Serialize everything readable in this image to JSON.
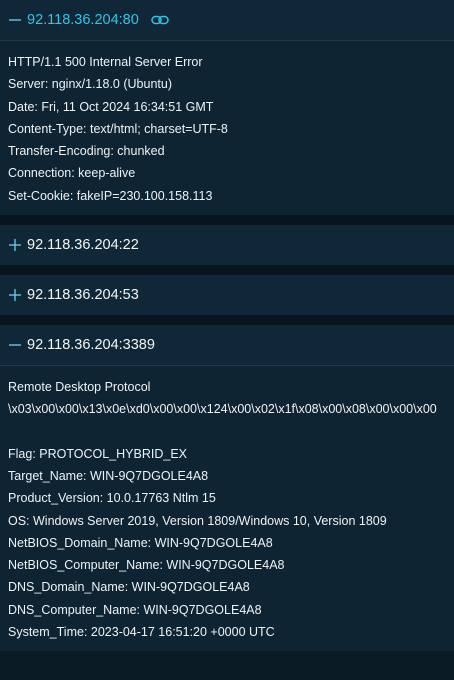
{
  "sections": [
    {
      "title": "92.118.36.204:80",
      "expanded": true,
      "has_link": true,
      "lines": [
        "HTTP/1.1 500 Internal Server Error",
        "Server: nginx/1.18.0 (Ubuntu)",
        "Date: Fri, 11 Oct 2024 16:34:51 GMT",
        "Content-Type: text/html; charset=UTF-8",
        "Transfer-Encoding: chunked",
        "Connection: keep-alive",
        "Set-Cookie: fakeIP=230.100.158.113"
      ]
    },
    {
      "title": "92.118.36.204:22",
      "expanded": false
    },
    {
      "title": "92.118.36.204:53",
      "expanded": false
    },
    {
      "title": "92.118.36.204:3389",
      "expanded": true,
      "lines_head": [
        "Remote Desktop Protocol",
        "\\x03\\x00\\x00\\x13\\x0e\\xd0\\x00\\x00\\x124\\x00\\x02\\x1f\\x08\\x00\\x08\\x00\\x00\\x00"
      ],
      "lines": [
        "Flag: PROTOCOL_HYBRID_EX",
        "Target_Name: WIN-9Q7DGOLE4A8",
        "Product_Version: 10.0.17763 Ntlm 15",
        "OS: Windows Server 2019, Version 1809/Windows 10, Version 1809",
        "NetBIOS_Domain_Name: WIN-9Q7DGOLE4A8",
        "NetBIOS_Computer_Name: WIN-9Q7DGOLE4A8",
        "DNS_Domain_Name: WIN-9Q7DGOLE4A8",
        "DNS_Computer_Name: WIN-9Q7DGOLE4A8",
        "System_Time: 2023-04-17 16:51:20 +0000 UTC"
      ]
    }
  ],
  "colors": {
    "accent": "#31c4e8",
    "toggle": "#6fc3e2",
    "background": "#0e2433"
  },
  "icons": {
    "collapse": "minus-icon",
    "expand": "plus-icon",
    "link": "link-icon"
  }
}
